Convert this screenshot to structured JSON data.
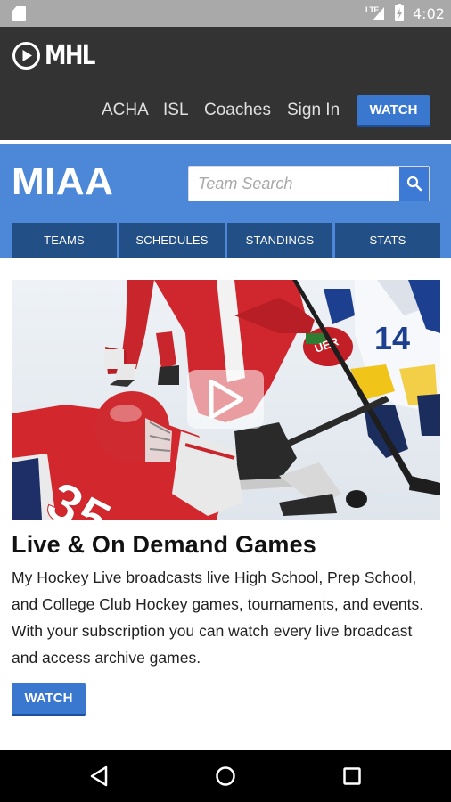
{
  "status_bar": {
    "time": "4:02",
    "network": "LTE",
    "icons": [
      "sd-card-icon",
      "signal-icon",
      "battery-charging-icon"
    ]
  },
  "header": {
    "logo_text": "MHL",
    "nav": {
      "acha": "ACHA",
      "isl": "ISL",
      "coaches": "Coaches",
      "sign_in": "Sign In"
    },
    "watch_label": "WATCH"
  },
  "league": {
    "title": "MIAA",
    "search_placeholder": "Team Search",
    "tabs": [
      "TEAMS",
      "SCHEDULES",
      "STANDINGS",
      "STATS"
    ]
  },
  "content": {
    "title": "Live & On Demand Games",
    "description": "My Hockey Live broadcasts live High School, Prep School, and College Club Hockey games, tournaments, and events. With your subscription you can watch every live broadcast and access archive games.",
    "watch_label": "WATCH",
    "hero": {
      "jersey_left": "35",
      "jersey_right": "14",
      "helmet_brand": "BAUER"
    }
  },
  "colors": {
    "status_bar": "#a9a9a9",
    "header": "#333333",
    "league_band": "#4c87d8",
    "tab": "#234f87",
    "button": "#3a78cf"
  }
}
